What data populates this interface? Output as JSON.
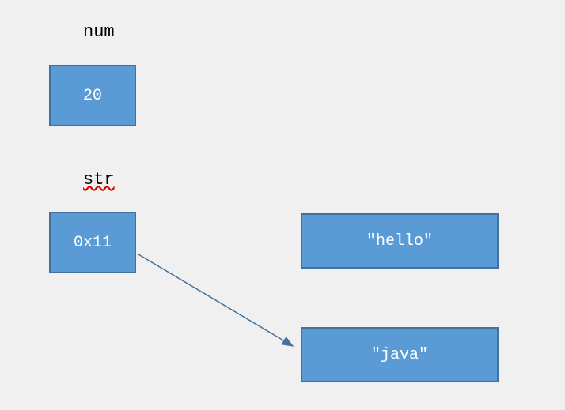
{
  "labels": {
    "num": "num",
    "str": "str"
  },
  "boxes": {
    "num_value": "20",
    "str_value": "0x11",
    "hello_value": "\"hello\"",
    "java_value": "\"java\""
  },
  "colors": {
    "box_fill": "#5b9bd5",
    "box_border": "#41719c",
    "arrow": "#41719c",
    "background": "#f0f0f0"
  }
}
